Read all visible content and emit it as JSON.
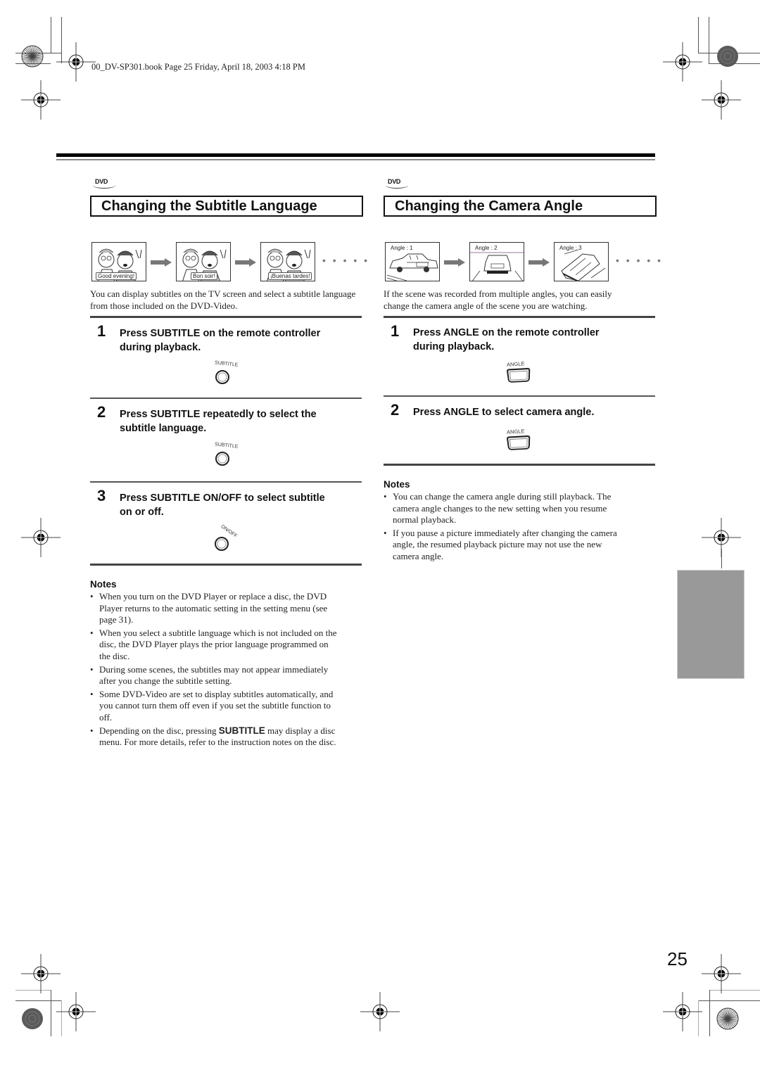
{
  "print_header": {
    "text": "00_DV-SP301.book  Page 25  Friday, April 18, 2003  4:18 PM"
  },
  "page_number": "25",
  "left_section": {
    "badge": "DVD",
    "title": "Changing the Subtitle Language",
    "illustrations": [
      {
        "caption": "Good evening!",
        "icon": "subtitle-scene"
      },
      {
        "caption": "Bon soir!",
        "icon": "subtitle-scene"
      },
      {
        "caption": "¡Buenas tardes!",
        "icon": "subtitle-scene"
      }
    ],
    "continuation": "• • • • •",
    "intro": "You can display subtitles on the TV screen and select a subtitle language from those included on the DVD-Video.",
    "steps": [
      {
        "number": "1",
        "line1": "Press SUBTITLE on the remote controller",
        "line2": "during playback.",
        "button_label": "SUBTITLE",
        "button_icon": "round-button-icon"
      },
      {
        "number": "2",
        "line1": "Press SUBTITLE repeatedly to select the",
        "line2": "subtitle language.",
        "button_label": "SUBTITLE",
        "button_icon": "round-button-icon"
      },
      {
        "number": "3",
        "line1": "Press SUBTITLE ON/OFF to select subtitle",
        "line2": "on or off.",
        "button_label": "ON/OFF",
        "button_icon": "round-button-icon"
      }
    ],
    "notes": {
      "title": "Notes",
      "items": [
        {
          "lines": [
            "When you turn on the DVD Player or replace a disc, the DVD",
            "Player returns to the automatic setting in the setting menu (see",
            "page 31)."
          ]
        },
        {
          "lines": [
            "When you select a subtitle language which is not included on the",
            "disc, the DVD Player plays the prior language programmed on",
            "the disc."
          ]
        },
        {
          "lines": [
            "During some scenes, the subtitles may not appear immediately",
            "after you change the subtitle setting."
          ]
        },
        {
          "lines": [
            "Some DVD-Video are set to display subtitles automatically, and",
            "you cannot turn them off even if you set the subtitle function to",
            "off."
          ]
        },
        {
          "pre": "Depending on the disc, pressing ",
          "bold": "SUBTITLE",
          "post": " may display a disc",
          "line2": "menu. For more details, refer to the instruction notes on the disc."
        }
      ]
    }
  },
  "right_section": {
    "badge": "DVD",
    "title": "Changing the Camera Angle",
    "illustrations": [
      {
        "caption": "Angle : 1",
        "icon": "car-side-view"
      },
      {
        "caption": "Angle : 2",
        "icon": "car-front-view"
      },
      {
        "caption": "Angle : 3",
        "icon": "car-top-view"
      }
    ],
    "continuation": "• • • • •",
    "intro_lines": [
      "If the scene was recorded from multiple angles, you can easily",
      "change the camera angle of the scene you are watching."
    ],
    "steps": [
      {
        "number": "1",
        "line1": "Press ANGLE on the remote controller",
        "line2": "during playback.",
        "button_label": "ANGLE",
        "button_icon": "angle-button-icon"
      },
      {
        "number": "2",
        "line1": "Press ANGLE to select camera angle.",
        "button_label": "ANGLE",
        "button_icon": "angle-button-icon"
      }
    ],
    "notes": {
      "title": "Notes",
      "items": [
        {
          "lines": [
            "You can change the camera angle during still playback. The",
            "camera angle changes to the new setting when you resume",
            "normal playback."
          ]
        },
        {
          "lines": [
            "If you pause a picture immediately after changing the camera",
            "angle, the resumed playback picture may not use the new",
            "camera angle."
          ]
        }
      ]
    }
  },
  "colors": {
    "text": "#1a1a1a",
    "rule": "#000000",
    "side_tab": "#999999"
  }
}
